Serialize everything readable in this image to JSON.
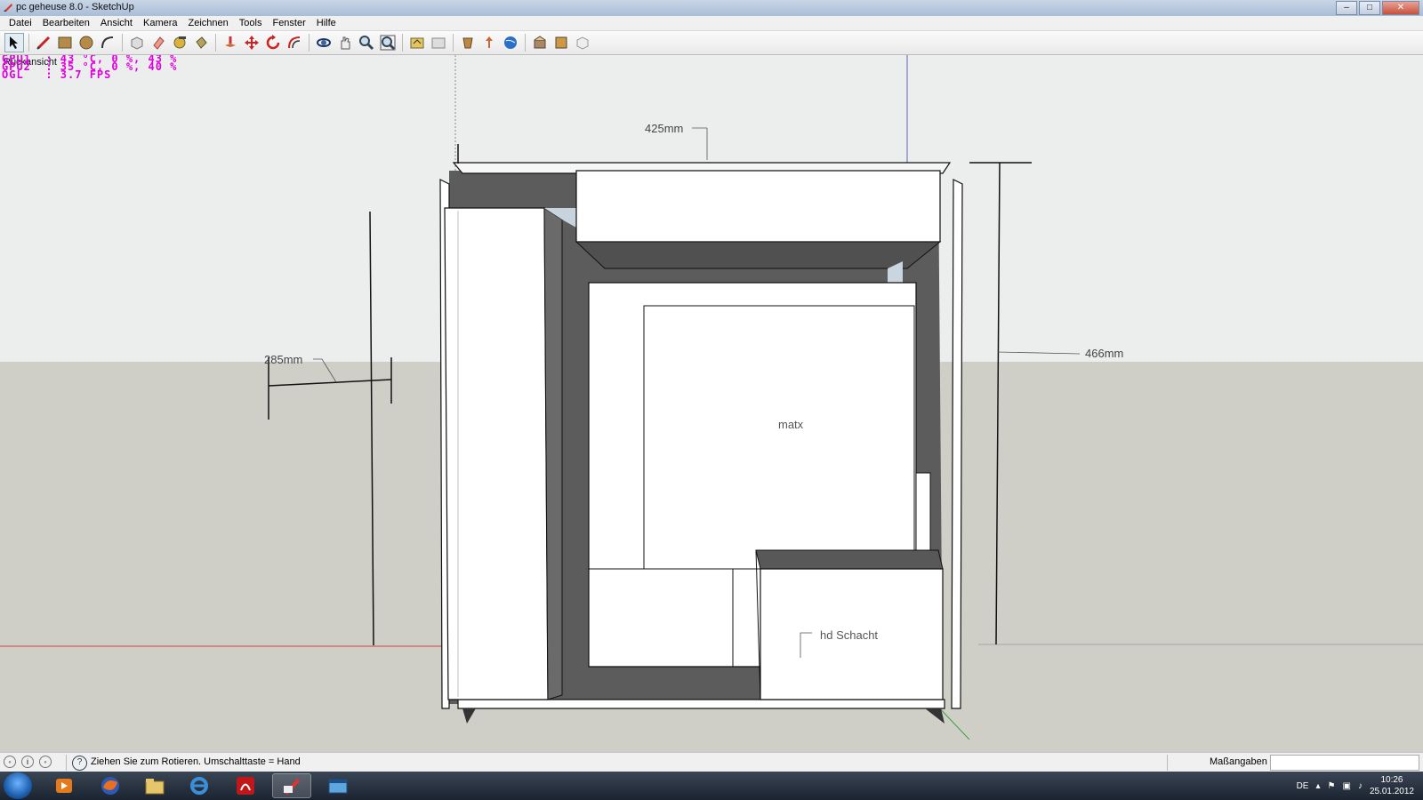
{
  "window": {
    "title": "pc geheuse 8.0 - SketchUp",
    "minimize": "–",
    "maximize": "□",
    "close": "✕"
  },
  "menu": [
    "Datei",
    "Bearbeiten",
    "Ansicht",
    "Kamera",
    "Zeichnen",
    "Tools",
    "Fenster",
    "Hilfe"
  ],
  "toolbar": {
    "tools": [
      "select-icon",
      "pencil-line-icon",
      "rectangle-icon",
      "circle-icon",
      "arc-icon",
      "make-component-icon",
      "eraser-icon",
      "tape-measure-icon",
      "paint-bucket-icon",
      "push-pull-icon",
      "move-icon",
      "rotate-icon",
      "offset-icon",
      "orbit-icon",
      "pan-icon",
      "zoom-icon",
      "zoom-extents-icon",
      "previous-view-icon",
      "next-view-icon",
      "get-models-icon",
      "share-model-icon",
      "google-earth-icon",
      "extension-warehouse-icon",
      "layout-icon",
      "section-icon"
    ]
  },
  "viewport": {
    "view_label": "Rückansicht",
    "osd_lines": [
      "GPU1  : 43 °C, 0 %, 43 %",
      "GPU2  : 35 °C, 0 %, 40 %",
      "OGL   : 3.7 FPS"
    ],
    "dimensions": {
      "width": "425mm",
      "height": "466mm",
      "depth": "285mm"
    },
    "labels": {
      "board": "matx",
      "bay": "hd Schacht"
    }
  },
  "statusbar": {
    "hint": "Ziehen Sie zum Rotieren.  Umschalttaste = Hand",
    "vcb_label": "Maßangaben",
    "vcb_value": "",
    "help": "?"
  },
  "taskbar": {
    "language": "DE",
    "time": "10:26",
    "date": "25.01.2012"
  },
  "colors": {
    "ground": "#cfcfc6",
    "sky": "#e9ecec",
    "dark_face": "#5a5a5a",
    "red_axis": "#d04040",
    "blue_axis": "#6060c0",
    "green_axis": "#40a040"
  }
}
